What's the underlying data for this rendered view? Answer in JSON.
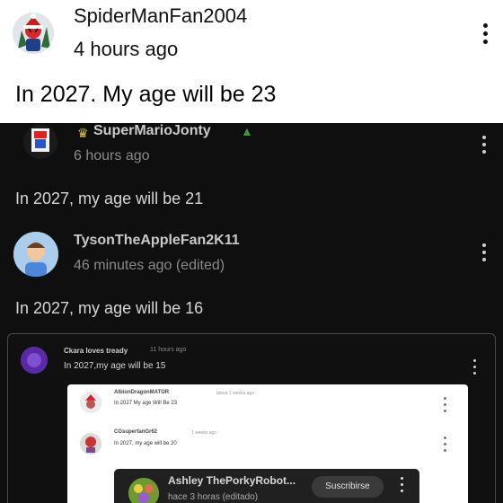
{
  "top_comment": {
    "username": "SpiderManFan2004",
    "time": "4 hours ago",
    "text": "In 2027. My age will be 23"
  },
  "comments": [
    {
      "username": "SuperMarioJonty",
      "time": "6 hours ago",
      "text": "In 2027, my age will be 21"
    },
    {
      "username": "TysonTheAppleFan2K11",
      "time": "46 minutes ago (edited)",
      "text": "In 2027, my age will be 16"
    }
  ],
  "embedded": {
    "username": "Ckara loves tready",
    "time": "11 hours ago",
    "text": "In 2027,my age will be 15",
    "replies": [
      {
        "username": "AlbionDragonMATOR",
        "time": "about 1 weeks ago",
        "text": "In 2027 My age Will Be 23"
      },
      {
        "username": "CGsuperfanGr62",
        "time": "1 weeks ago",
        "text": "In 2027, my age will be 20"
      }
    ],
    "overlay": {
      "username": "Ashley ThePorkyRobot...",
      "time": "hace 3 horas (editado)",
      "subscribe_label": "Suscribirse"
    }
  },
  "colors": {
    "dark_bg": "#0f0f0f",
    "embedded_border": "#4a4a4a"
  }
}
